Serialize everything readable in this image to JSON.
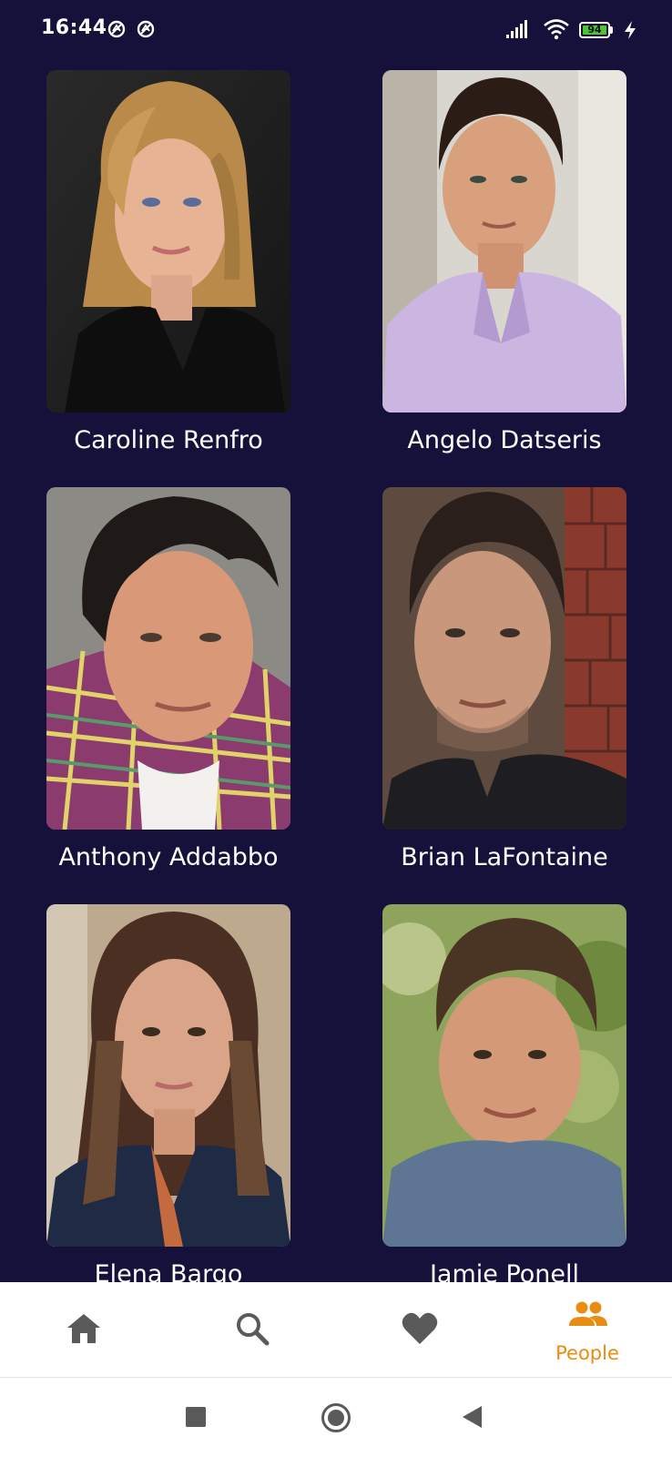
{
  "status_bar": {
    "time": "16:44",
    "notification_icons": [
      "vpn-badge-icon",
      "vpn-badge-icon"
    ],
    "battery_level": "94",
    "icons": [
      "signal-icon",
      "wifi-icon",
      "battery-icon",
      "charging-bolt-icon"
    ]
  },
  "people": [
    {
      "name": "Caroline Renfro"
    },
    {
      "name": "Angelo Datseris"
    },
    {
      "name": "Anthony Addabbo"
    },
    {
      "name": "Brian LaFontaine"
    },
    {
      "name": "Elena Bargo"
    },
    {
      "name": "Jamie Ponell"
    }
  ],
  "bottom_nav": {
    "items": [
      {
        "icon": "home-icon",
        "label": ""
      },
      {
        "icon": "search-icon",
        "label": ""
      },
      {
        "icon": "heart-icon",
        "label": ""
      },
      {
        "icon": "people-icon",
        "label": "People"
      }
    ],
    "active_index": 3
  },
  "colors": {
    "background": "#15113a",
    "accent": "#e88d12",
    "nav_icon": "#5a5a5a",
    "text": "#ffffff"
  },
  "system_nav": [
    "recents-square-icon",
    "home-circle-icon",
    "back-triangle-icon"
  ]
}
